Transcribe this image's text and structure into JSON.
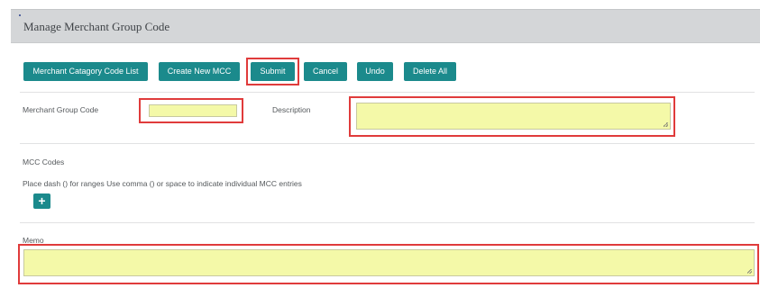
{
  "header": {
    "title": "Manage Merchant Group Code"
  },
  "toolbar": {
    "buttons": [
      {
        "label": "Merchant Catagory Code List"
      },
      {
        "label": "Create New MCC"
      },
      {
        "label": "Submit"
      },
      {
        "label": "Cancel"
      },
      {
        "label": "Undo"
      },
      {
        "label": "Delete All"
      }
    ]
  },
  "form": {
    "merchant_group_code": {
      "label": "Merchant Group Code",
      "value": ""
    },
    "description": {
      "label": "Description",
      "value": ""
    },
    "mcc_codes": {
      "label": "MCC Codes",
      "hint": "Place dash () for ranges Use comma () or space to indicate individual MCC entries",
      "add_icon": "plus-icon",
      "add_glyph": "+"
    },
    "memo": {
      "label": "Memo",
      "value": ""
    }
  },
  "colors": {
    "accent": "#1b8a8c",
    "highlight": "#e03b3b",
    "field_fill": "#f4f9a8",
    "header_bg": "#d4d6d8"
  }
}
